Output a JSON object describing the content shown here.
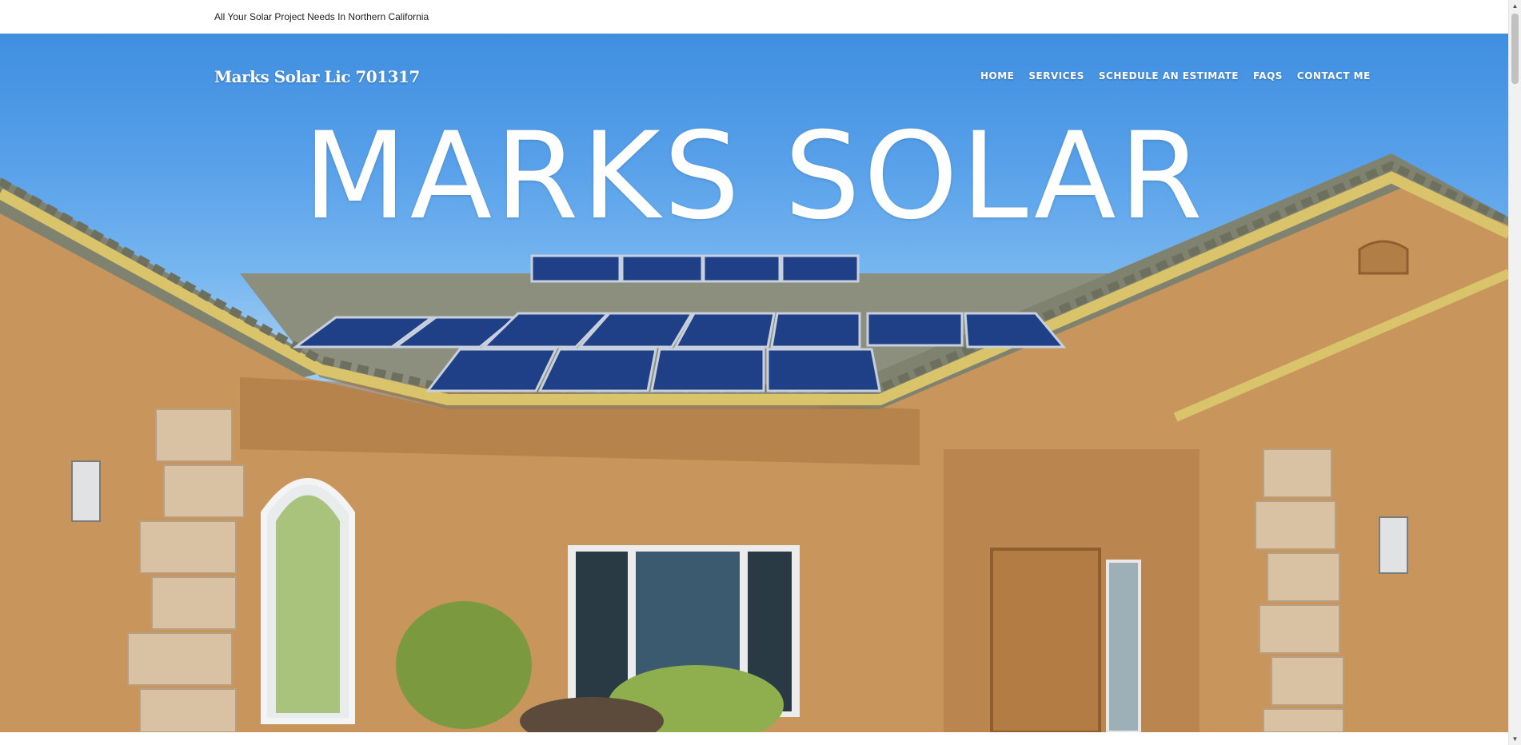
{
  "topbar": {
    "tagline": "All Your Solar Project Needs In Northern California"
  },
  "header": {
    "brand": "Marks Solar Lic 701317",
    "nav": [
      {
        "label": "HOME"
      },
      {
        "label": "SERVICES"
      },
      {
        "label": "SCHEDULE AN ESTIMATE"
      },
      {
        "label": "FAQS"
      },
      {
        "label": "CONTACT ME"
      }
    ]
  },
  "hero": {
    "title": "MARKS SOLAR"
  },
  "colors": {
    "sky": "#4a95e3",
    "stucco": "#c8955c",
    "roof": "#8c8f7e",
    "trim": "#d9c46c",
    "panel": "#1f3f86",
    "text": "#ffffff"
  }
}
